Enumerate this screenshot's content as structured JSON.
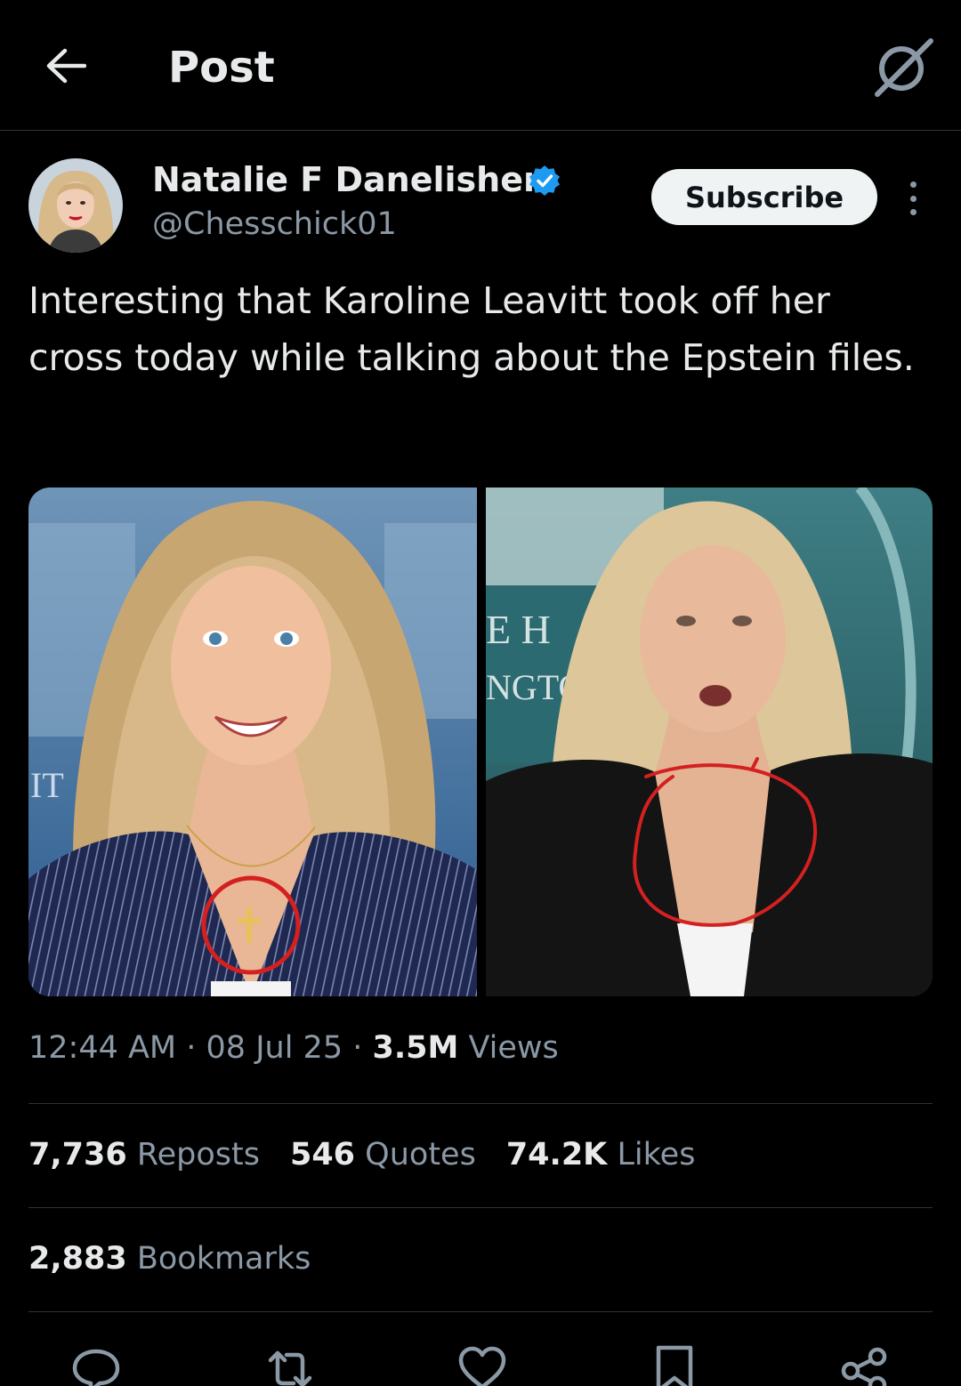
{
  "header": {
    "title": "Post",
    "back_icon": "arrow-left-icon",
    "grok_icon": "grok-icon"
  },
  "author": {
    "name": "Natalie F Danelishen",
    "handle": "@Chesschick01",
    "verified": true,
    "subscribe_label": "Subscribe"
  },
  "tweet": {
    "text": "Interesting that Karoline Leavitt took off her cross today while talking about the Epstein files.",
    "time": "12:44 AM",
    "date": "08 Jul 25",
    "views_count": "3.5M",
    "views_label": "Views"
  },
  "media": {
    "left_sign_text": "IT",
    "right_sign_line1": "E H",
    "right_sign_line2": "NGTO"
  },
  "stats": {
    "reposts_count": "7,736",
    "reposts_label": "Reposts",
    "quotes_count": "546",
    "quotes_label": "Quotes",
    "likes_count": "74.2K",
    "likes_label": "Likes",
    "bookmarks_count": "2,883",
    "bookmarks_label": "Bookmarks"
  },
  "actions": [
    "reply-icon",
    "repost-icon",
    "like-icon",
    "bookmark-icon",
    "share-icon"
  ],
  "colors": {
    "background": "#000000",
    "text_primary": "#e7e9ea",
    "text_secondary": "#8b98a5",
    "divider": "#2f3336",
    "verified_blue": "#1d9bf0",
    "annotation_red": "#d42020"
  }
}
